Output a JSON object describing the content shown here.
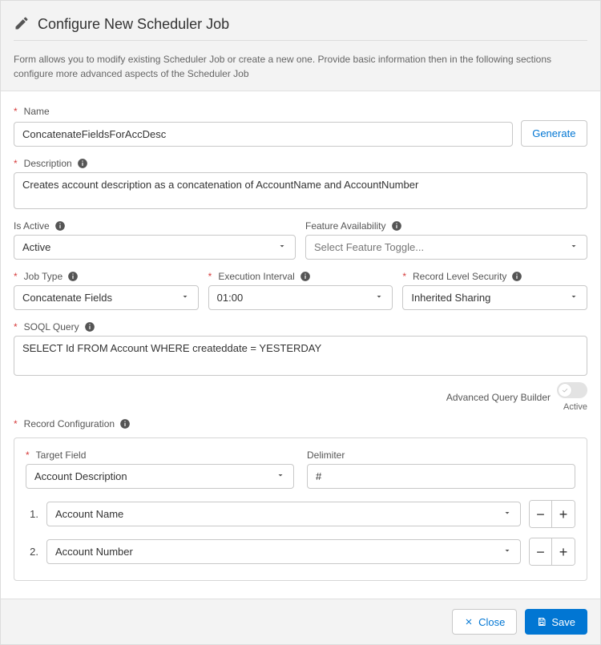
{
  "header": {
    "title": "Configure New Scheduler Job",
    "description": "Form allows you to modify existing Scheduler Job or create a new one. Provide basic information then in the following sections configure more advanced aspects of the Scheduler Job"
  },
  "labels": {
    "name": "Name",
    "generate": "Generate",
    "description": "Description",
    "isActive": "Is Active",
    "featureAvailability": "Feature Availability",
    "jobType": "Job Type",
    "executionInterval": "Execution Interval",
    "recordLevelSecurity": "Record Level Security",
    "soqlQuery": "SOQL Query",
    "advancedQueryBuilder": "Advanced Query Builder",
    "aqbStatus": "Active",
    "recordConfiguration": "Record Configuration",
    "targetField": "Target Field",
    "delimiter": "Delimiter"
  },
  "values": {
    "name": "ConcatenateFieldsForAccDesc",
    "description": "Creates account description as a concatenation of AccountName and AccountNumber",
    "isActive": "Active",
    "featureAvailabilityPlaceholder": "Select Feature Toggle...",
    "jobType": "Concatenate Fields",
    "executionInterval": "01:00",
    "recordLevelSecurity": "Inherited Sharing",
    "soqlQuery": "SELECT Id FROM Account WHERE createddate = YESTERDAY",
    "targetField": "Account Description",
    "delimiter": "#",
    "fieldRows": [
      {
        "index": "1.",
        "value": "Account Name"
      },
      {
        "index": "2.",
        "value": "Account Number"
      }
    ]
  },
  "footer": {
    "close": "Close",
    "save": "Save"
  }
}
